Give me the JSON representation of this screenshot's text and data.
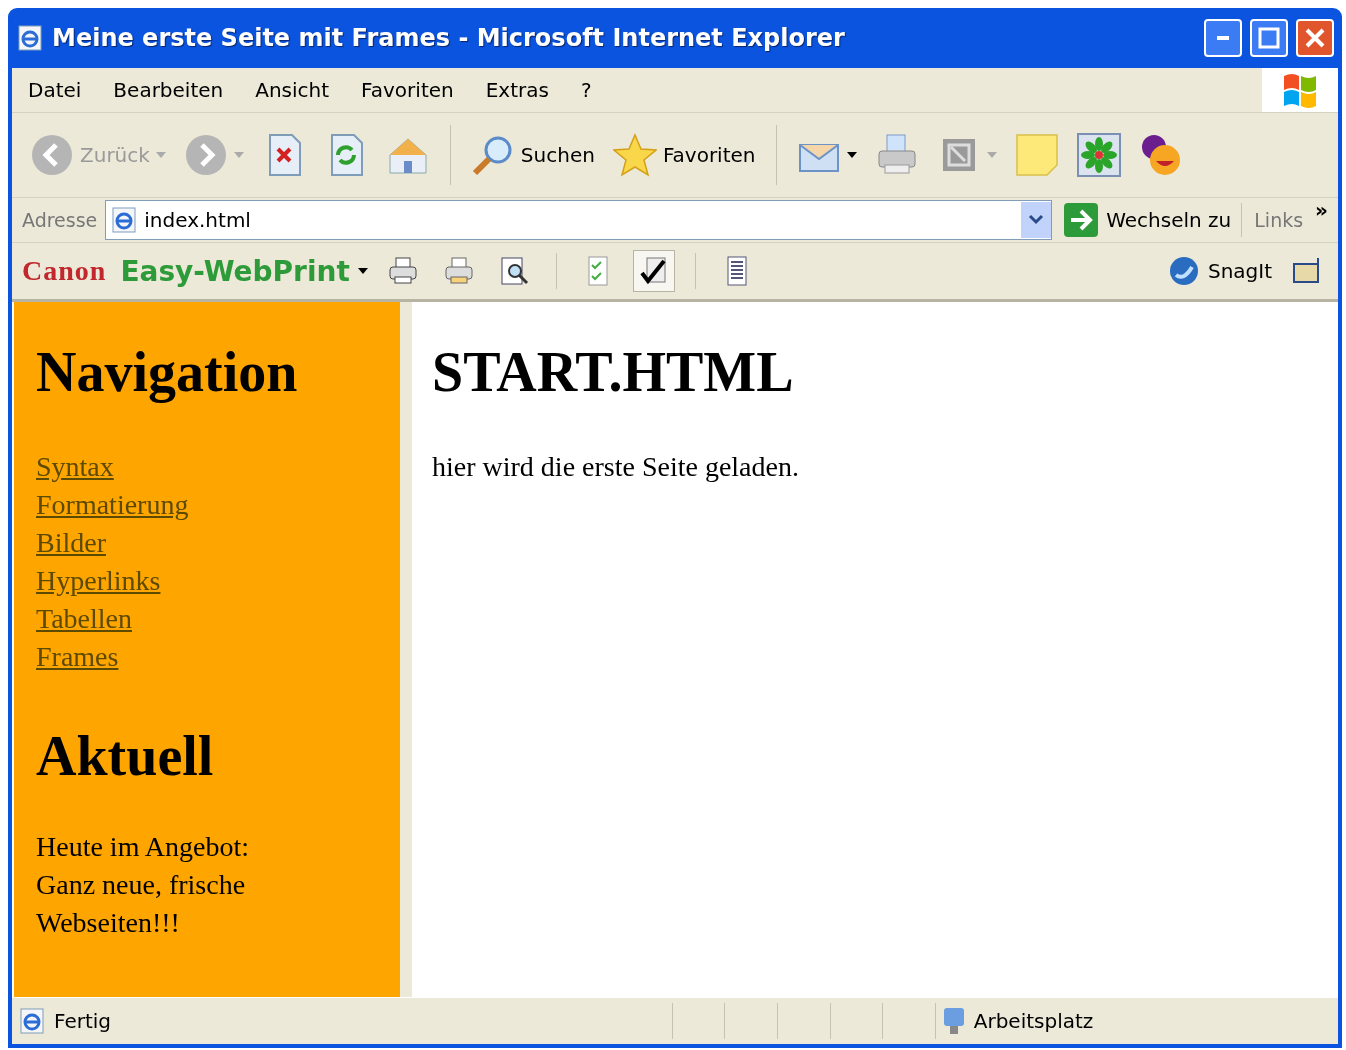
{
  "window": {
    "title": "Meine erste Seite mit Frames - Microsoft Internet Explorer"
  },
  "menu": [
    "Datei",
    "Bearbeiten",
    "Ansicht",
    "Favoriten",
    "Extras",
    "?"
  ],
  "toolbar": [
    {
      "kind": "back",
      "label": "Zurück",
      "disabled": true,
      "dropdown": true
    },
    {
      "kind": "forward",
      "disabled": true,
      "dropdown": true
    },
    {
      "kind": "stop"
    },
    {
      "kind": "refresh"
    },
    {
      "kind": "home"
    },
    {
      "kind": "separator"
    },
    {
      "kind": "search",
      "label": "Suchen"
    },
    {
      "kind": "star",
      "label": "Favoriten"
    },
    {
      "kind": "separator"
    },
    {
      "kind": "mail",
      "dropdown": true
    },
    {
      "kind": "print"
    },
    {
      "kind": "frame",
      "dropdown": true,
      "disabled": true
    },
    {
      "kind": "note"
    },
    {
      "kind": "flower"
    },
    {
      "kind": "smiley"
    }
  ],
  "address": {
    "label": "Adresse",
    "value": "index.html",
    "go": "Wechseln zu",
    "links": "Links",
    "more": "»"
  },
  "canon_bar": {
    "brand": "Canon",
    "product": "Easy-WebPrint",
    "tools": [
      {
        "kind": "printer",
        "pressed": false
      },
      {
        "kind": "printer2",
        "pressed": false
      },
      {
        "kind": "preview",
        "pressed": false
      },
      {
        "kind": "separator"
      },
      {
        "kind": "checklist",
        "pressed": false
      },
      {
        "kind": "checkmark",
        "pressed": true
      },
      {
        "kind": "separator"
      },
      {
        "kind": "list",
        "pressed": false
      }
    ],
    "snagit": "SnagIt"
  },
  "left_frame": {
    "heading": "Navigation",
    "links": [
      "Syntax",
      "Formatierung",
      "Bilder",
      "Hyperlinks",
      "Tabellen",
      "Frames"
    ],
    "heading2": "Aktuell",
    "text": "Heute im Angebot: Ganz neue, frische Webseiten!!!"
  },
  "right_frame": {
    "heading": "START.HTML",
    "text": "hier wird die erste Seite geladen."
  },
  "status_bar": {
    "text": "Fertig",
    "zone": "Arbeitsplatz"
  }
}
